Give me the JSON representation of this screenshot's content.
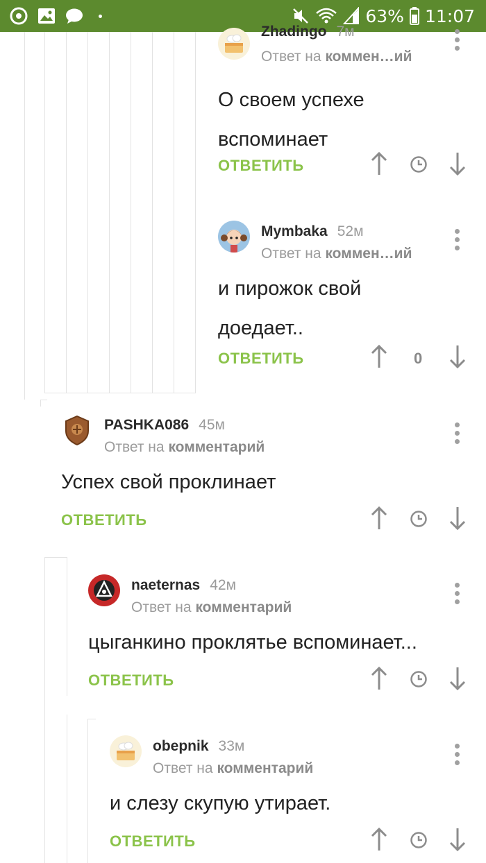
{
  "status_bar": {
    "battery": "63%",
    "time": "11:07"
  },
  "comments": [
    {
      "username": "Zhadingo",
      "time": "7м",
      "reply_prefix": "Ответ на",
      "reply_target": "коммен…ий",
      "text_lines": [
        "О своем успехе",
        "вспоминает"
      ],
      "reply_label": "ОТВЕТИТЬ",
      "avatar": "cake-avatar-icon"
    },
    {
      "username": "Mymbaka",
      "time": "52м",
      "reply_prefix": "Ответ на",
      "reply_target": "коммен…ий",
      "text_lines": [
        "и пирожок свой",
        "доедает.."
      ],
      "reply_label": "ОТВЕТИТЬ",
      "rating": "0",
      "avatar": "girl-avatar-icon"
    },
    {
      "username": "PASHKA086",
      "time": "45м",
      "reply_prefix": "Ответ на",
      "reply_target": "комментарий",
      "text_lines": [
        "Успех свой проклинает"
      ],
      "reply_label": "ОТВЕТИТЬ",
      "avatar": "badge-avatar-icon"
    },
    {
      "username": "naeternas",
      "time": "42м",
      "reply_prefix": "Ответ на",
      "reply_target": "комментарий",
      "text_lines": [
        "цыганкино проклятье вспоминает..."
      ],
      "reply_label": "ОТВЕТИТЬ",
      "avatar": "emblem-avatar-icon"
    },
    {
      "username": "obepnik",
      "time": "33м",
      "reply_prefix": "Ответ на",
      "reply_target": "комментарий",
      "text_lines": [
        "и слезу скупую утирает."
      ],
      "reply_label": "ОТВЕТИТЬ",
      "avatar": "cake-avatar-icon"
    }
  ],
  "colors": {
    "status_bar": "#5c8a2e",
    "reply_button": "#8bc34a",
    "guide_line": "#e3e3e3"
  }
}
